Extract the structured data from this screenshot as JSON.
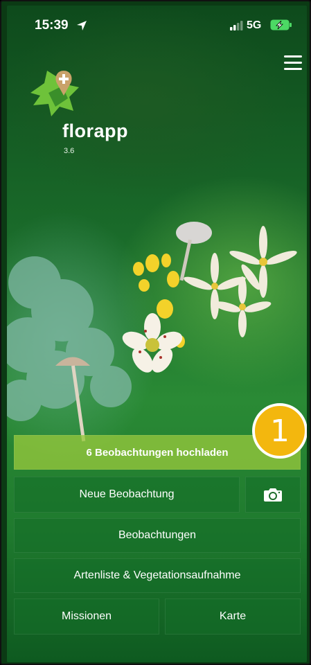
{
  "status_bar": {
    "time": "15:39",
    "network": "5G"
  },
  "app": {
    "name": "florapp",
    "version": "3.6"
  },
  "buttons": {
    "upload": "6 Beobachtungen hochladen",
    "new_observation": "Neue Beobachtung",
    "observations": "Beobachtungen",
    "species_list": "Artenliste & Vegetationsaufnahme",
    "missions": "Missionen",
    "map": "Karte"
  },
  "annotation": {
    "badge": "1"
  },
  "colors": {
    "badge": "#f3b70e",
    "upload_button": "#96c83c",
    "logo_marker": "#c9a26a"
  },
  "icons": [
    "location-arrow-icon",
    "signal-icon",
    "battery-icon",
    "hamburger-menu-icon",
    "camera-icon"
  ]
}
